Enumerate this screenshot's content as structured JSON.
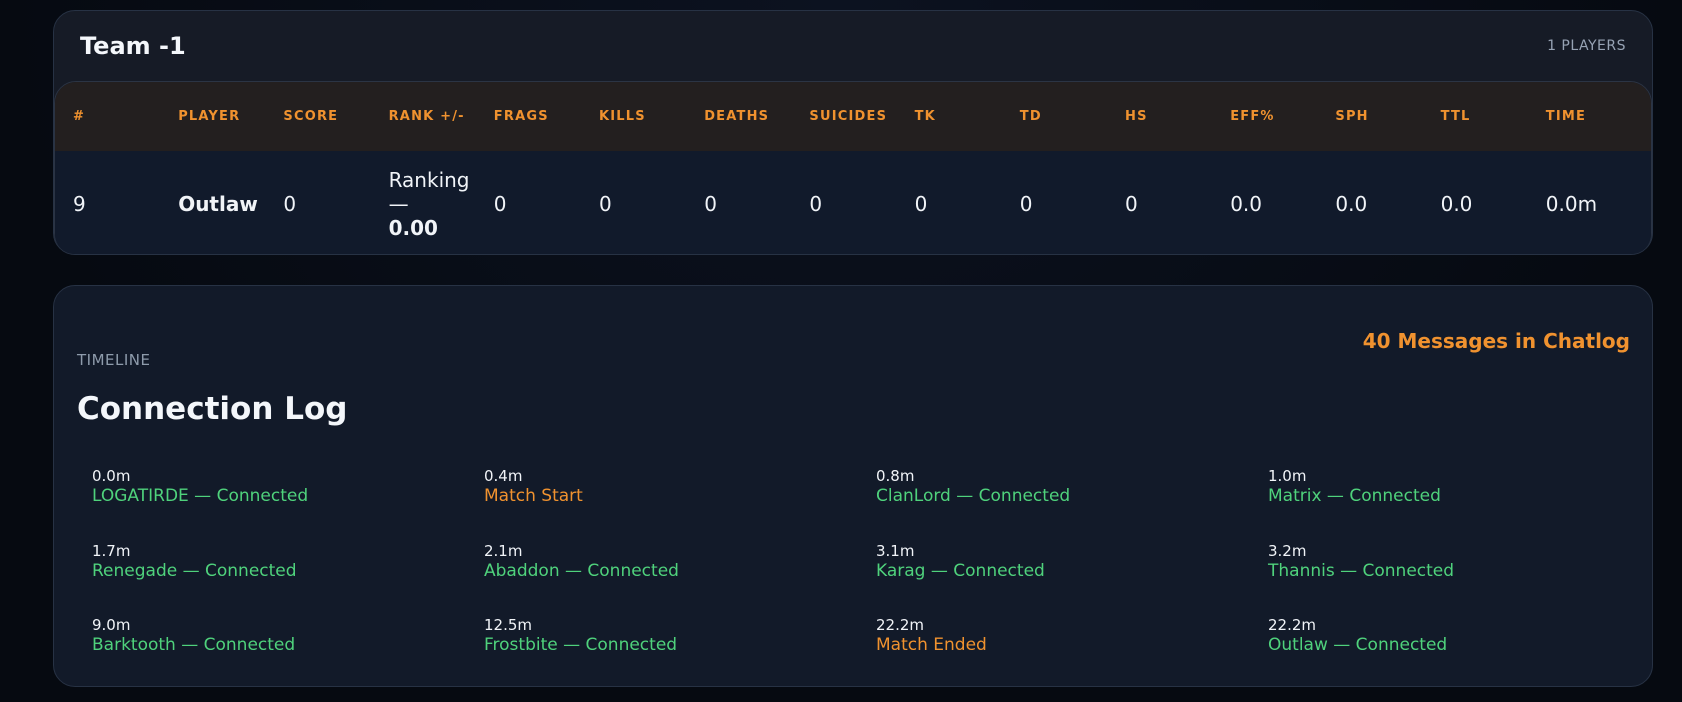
{
  "team": {
    "title": "Team -1",
    "player_count": "1 PLAYERS"
  },
  "table": {
    "headers": [
      "#",
      "PLAYER",
      "SCORE",
      "RANK +/-",
      "FRAGS",
      "KILLS",
      "DEATHS",
      "SUICIDES",
      "TK",
      "TD",
      "HS",
      "EFF%",
      "SPH",
      "TTL",
      "TIME"
    ],
    "row": {
      "num": "9",
      "player": "Outlaw",
      "score": "0",
      "rank_label": "Ranking —",
      "rank_value": "0.00",
      "frags": "0",
      "kills": "0",
      "deaths": "0",
      "suicides": "0",
      "tk": "0",
      "td": "0",
      "hs": "0",
      "eff": "0.0",
      "sph": "0.0",
      "ttl": "0.0",
      "time": "0.0m"
    }
  },
  "timeline": {
    "kicker": "TIMELINE",
    "title": "Connection Log",
    "chat_count": "40 Messages in Chatlog",
    "events": [
      {
        "time": "0.0m",
        "text": "LOGATIRDE — Connected",
        "kind": "ok"
      },
      {
        "time": "0.4m",
        "text": "Match Start",
        "kind": "warn"
      },
      {
        "time": "0.8m",
        "text": "ClanLord — Connected",
        "kind": "ok"
      },
      {
        "time": "1.0m",
        "text": "Matrix — Connected",
        "kind": "ok"
      },
      {
        "time": "1.7m",
        "text": "Renegade — Connected",
        "kind": "ok"
      },
      {
        "time": "2.1m",
        "text": "Abaddon — Connected",
        "kind": "ok"
      },
      {
        "time": "3.1m",
        "text": "Karag — Connected",
        "kind": "ok"
      },
      {
        "time": "3.2m",
        "text": "Thannis — Connected",
        "kind": "ok"
      },
      {
        "time": "9.0m",
        "text": "Barktooth — Connected",
        "kind": "ok"
      },
      {
        "time": "12.5m",
        "text": "Frostbite — Connected",
        "kind": "ok"
      },
      {
        "time": "22.2m",
        "text": "Match Ended",
        "kind": "warn"
      },
      {
        "time": "22.2m",
        "text": "Outlaw — Connected",
        "kind": "ok"
      }
    ]
  },
  "colors": {
    "accent": "#f0922f",
    "connected": "#4fd27c",
    "background": "#070b12"
  }
}
